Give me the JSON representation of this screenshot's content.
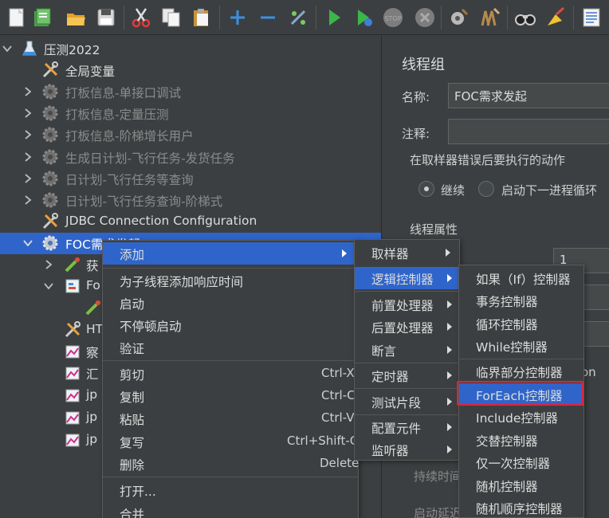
{
  "toolbar": {
    "icons": [
      "new-icon",
      "templates-icon",
      "open-icon",
      "save-icon",
      "cut-icon",
      "copy-icon",
      "paste-icon",
      "expand-icon",
      "collapse-icon",
      "toggle-icon",
      "start-icon",
      "start-no-pause-icon",
      "stop-icon",
      "shutdown-icon",
      "clear-icon",
      "clear-all-icon",
      "search-icon",
      "reset-search-icon",
      "function-helper-icon"
    ]
  },
  "tree": {
    "root": "压测2022",
    "items": [
      {
        "label": "全局变量",
        "icon": "config-element-icon"
      },
      {
        "label": "打板信息-单接口调试",
        "icon": "thread-group-icon"
      },
      {
        "label": "打板信息-定量压测",
        "icon": "thread-group-icon"
      },
      {
        "label": "打板信息-阶梯增长用户",
        "icon": "thread-group-icon"
      },
      {
        "label": "生成日计划-飞行任务-发货任务",
        "icon": "thread-group-icon"
      },
      {
        "label": "日计划-飞行任务等查询",
        "icon": "thread-group-icon"
      },
      {
        "label": "日计划-飞行任务查询-阶梯式",
        "icon": "thread-group-icon"
      },
      {
        "label": "JDBC Connection Configuration",
        "icon": "config-element-icon"
      },
      {
        "label": "FOC需求发起",
        "icon": "thread-group-icon"
      }
    ],
    "children": [
      {
        "label": "获",
        "icon": "sampler-icon"
      },
      {
        "label": "Fo",
        "icon": "controller-icon"
      },
      {
        "label": "HT",
        "icon": "config-element-icon"
      },
      {
        "label": "察",
        "icon": "listener-icon"
      },
      {
        "label": "汇",
        "icon": "listener-icon"
      },
      {
        "label": "jp",
        "icon": "listener-icon"
      },
      {
        "label": "jp",
        "icon": "listener-icon"
      },
      {
        "label": "jp",
        "icon": "listener-icon"
      }
    ]
  },
  "panel": {
    "title": "线程组",
    "name_label": "名称:",
    "name_value": "FOC需求发起",
    "comment_label": "注释:",
    "comment_value": "",
    "error_action_label": "在取样器错误后要执行的动作",
    "radio_continue": "继续",
    "radio_next_loop": "启动下一进程循环",
    "thread_props_label": "线程属性",
    "threads_value": "1",
    "partial_label_1": "on",
    "duration_label": "持续时间",
    "delay_label": "启动延迟"
  },
  "context_menu": {
    "items": [
      {
        "label": "添加",
        "submenu": true
      },
      {
        "label": "为子线程添加响应时间"
      },
      {
        "label": "启动"
      },
      {
        "label": "不停顿启动"
      },
      {
        "label": "验证"
      },
      {
        "label": "剪切",
        "shortcut": "Ctrl-X"
      },
      {
        "label": "复制",
        "shortcut": "Ctrl-C"
      },
      {
        "label": "粘贴",
        "shortcut": "Ctrl-V"
      },
      {
        "label": "复写",
        "shortcut": "Ctrl+Shift-C"
      },
      {
        "label": "删除",
        "shortcut": "Delete"
      },
      {
        "label": "打开..."
      },
      {
        "label": "合并"
      }
    ]
  },
  "add_menu": {
    "items": [
      "取样器",
      "逻辑控制器",
      "前置处理器",
      "后置处理器",
      "断言",
      "定时器",
      "测试片段",
      "配置元件",
      "监听器"
    ]
  },
  "logic_menu": {
    "items": [
      "如果（If）控制器",
      "事务控制器",
      "循环控制器",
      "While控制器",
      "临界部分控制器",
      "ForEach控制器",
      "Include控制器",
      "交替控制器",
      "仅一次控制器",
      "随机控制器",
      "随机顺序控制器"
    ]
  },
  "colors": {
    "background": "#3c3f41",
    "highlight": "#2f65ca",
    "annotation": "#e0223c"
  }
}
